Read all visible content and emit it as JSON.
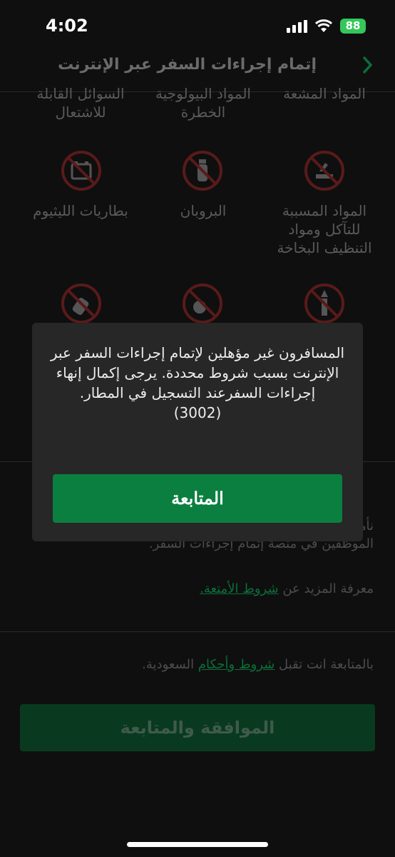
{
  "status": {
    "time": "4:02",
    "battery": "88"
  },
  "header": {
    "title": "إتمام إجراءات السفر عبر الإنترنت"
  },
  "items_top_row": [
    {
      "label": "المواد المشعة"
    },
    {
      "label": "المواد البيولوجية الخطرة"
    },
    {
      "label": "السوائل القابلة للاشتعال"
    }
  ],
  "items_mid_row": [
    {
      "label": "المواد المسببة للتآكل ومواد التنظيف البخاخة",
      "icon": "corrosive-icon"
    },
    {
      "label": "البروبان",
      "icon": "propane-icon"
    },
    {
      "label": "بطاريات الليثيوم",
      "icon": "battery-icon"
    }
  ],
  "items_bottom_row": [
    {
      "icon": "fireworks-icon"
    },
    {
      "icon": "explosive-icon"
    },
    {
      "icon": "spray-bottle-icon"
    }
  ],
  "info": {
    "paragraph": "نأمل في حال عدم التأكد من المواد المسموحة التحدث إلى أحد الموظفين في منصة إتمام إجراءات السفر.",
    "more_prefix": "معرفة المزيد عن",
    "more_link": "شروط الأمتعة."
  },
  "terms": {
    "prefix": "بالمتابعة انت تقبل",
    "link": "شروط وأحكام",
    "suffix": "السعودية."
  },
  "accept_button": "الموافقة والمتابعة",
  "modal": {
    "message": "المسافرون غير مؤهلين لإتمام إجراءات السفر عبر الإنترنت بسبب شروط محددة. يرجى إكمال إنهاء إجراءات السفرعند التسجيل في المطار.",
    "code": "(3002)",
    "button": "المتابعة"
  },
  "colors": {
    "accent": "#0b7f3f",
    "modal_bg": "#272727",
    "link": "#0c6e3a"
  }
}
